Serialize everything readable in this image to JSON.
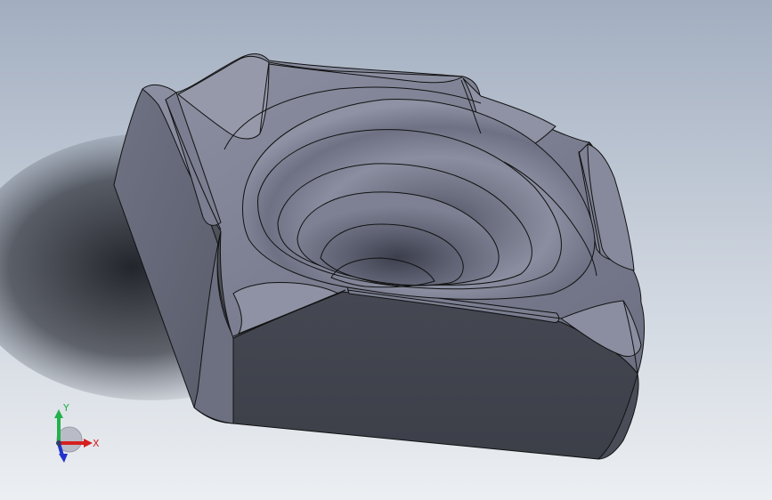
{
  "app": {
    "background_top": "#a4b0c2",
    "background_bottom": "#e9edf1"
  },
  "model": {
    "body_color": "#6a6e7e",
    "edge_color": "#111111"
  },
  "triad": {
    "x_label": "X",
    "y_label": "Y",
    "x_color": "#d62020",
    "y_color": "#22b14c",
    "z_color": "#2233cc"
  }
}
